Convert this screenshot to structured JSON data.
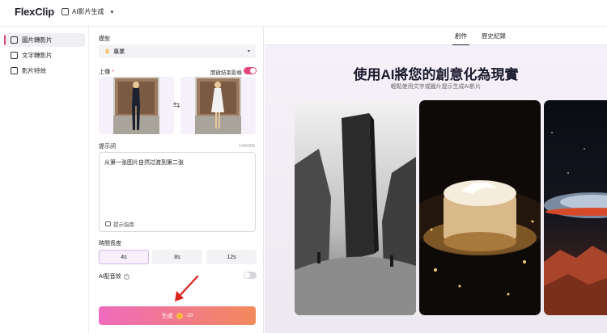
{
  "app": {
    "logo_text": "FlexClip",
    "breadcrumb": "AI影片生成"
  },
  "leftnav": {
    "items": [
      {
        "label": "圖片轉影片",
        "active": true
      },
      {
        "label": "文字轉影片",
        "active": false
      },
      {
        "label": "影片特效",
        "active": false
      }
    ]
  },
  "panel": {
    "model_label": "模型",
    "model_value": "專業",
    "upload_label": "上傳",
    "required_mark": "*",
    "end_frame_label": "開啟結束影格",
    "end_frame_on": true,
    "prompt_label": "提示詞",
    "prompt_counter": "14/5000",
    "prompt_value": "从第一张图片自然过渡到第二张",
    "prompt_guide": "提示指南",
    "duration_label": "時間長度",
    "durations": [
      "4s",
      "8s",
      "12s"
    ],
    "selected_duration": "4s",
    "ai_audio_label": "AI配音效",
    "ai_audio_on": false,
    "help_glyph": "?",
    "generate_label": "生成",
    "generate_cost": "-20"
  },
  "right": {
    "tabs": [
      {
        "label": "創作",
        "active": true
      },
      {
        "label": "歷史紀錄",
        "active": false
      }
    ],
    "hero_title": "使用AI將您的創意化為現實",
    "hero_subtitle": "輕鬆使用文字或圖片提示生成AI影片"
  },
  "colors": {
    "accent": "#e0487b",
    "button_start": "#f06bbd",
    "button_end": "#f2895b",
    "annotation": "#d9241f"
  }
}
